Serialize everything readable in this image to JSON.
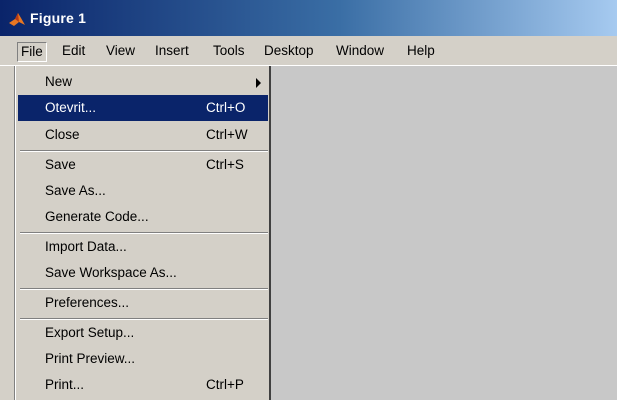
{
  "window": {
    "title": "Figure 1",
    "icon": "matlab-logo-icon"
  },
  "menubar": {
    "file": "File",
    "edit": "Edit",
    "view": "View",
    "insert": "Insert",
    "tools": "Tools",
    "desktop": "Desktop",
    "window": "Window",
    "help": "Help"
  },
  "file_menu": {
    "new": {
      "label": "New"
    },
    "open": {
      "label": "Otevrit...",
      "shortcut": "Ctrl+O"
    },
    "close": {
      "label": "Close",
      "shortcut": "Ctrl+W"
    },
    "save": {
      "label": "Save",
      "shortcut": "Ctrl+S"
    },
    "save_as": {
      "label": "Save As..."
    },
    "generate_code": {
      "label": "Generate Code..."
    },
    "import_data": {
      "label": "Import Data..."
    },
    "save_workspace_as": {
      "label": "Save Workspace As..."
    },
    "preferences": {
      "label": "Preferences..."
    },
    "export_setup": {
      "label": "Export Setup..."
    },
    "print_preview": {
      "label": "Print Preview..."
    },
    "print": {
      "label": "Print...",
      "shortcut": "Ctrl+P"
    }
  },
  "colors": {
    "highlight": "#0a246a",
    "menu_bg": "#d4d0c8",
    "canvas_bg": "#c8c8c8"
  }
}
